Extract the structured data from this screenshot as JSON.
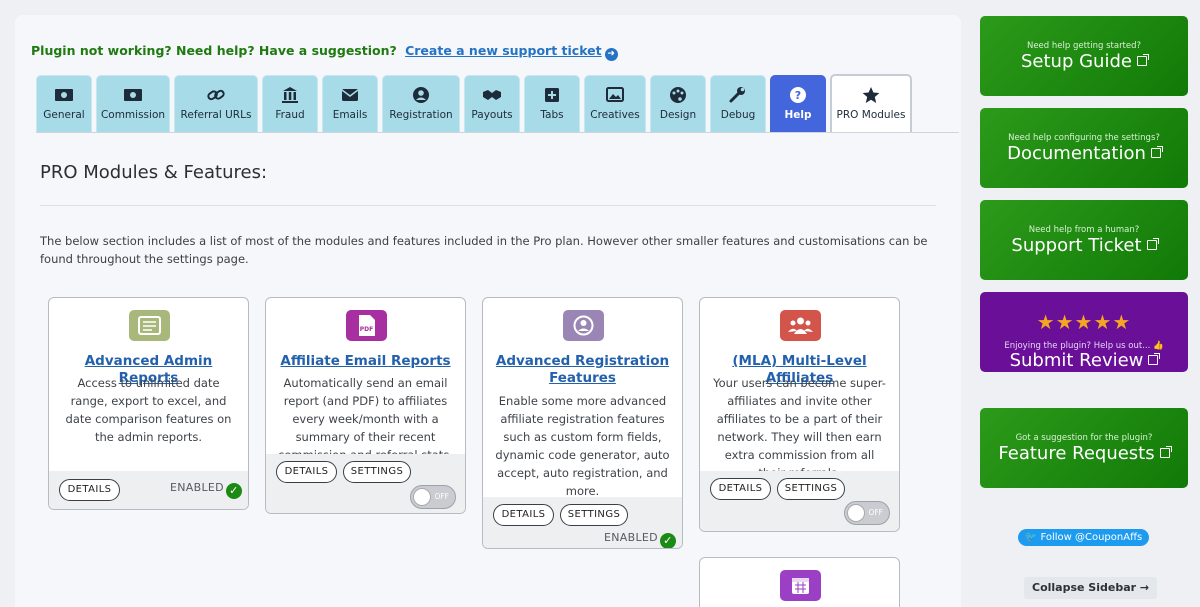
{
  "help_bar": {
    "prompt": "Plugin not working? Need help? Have a suggestion?",
    "link": "Create a new support ticket",
    "arrow": "➜"
  },
  "tabs": [
    {
      "label": "General",
      "icon": "money-icon"
    },
    {
      "label": "Commission",
      "icon": "money-icon"
    },
    {
      "label": "Referral URLs",
      "icon": "link-icon"
    },
    {
      "label": "Fraud",
      "icon": "building-icon"
    },
    {
      "label": "Emails",
      "icon": "envelope-icon"
    },
    {
      "label": "Registration",
      "icon": "user-circle-icon"
    },
    {
      "label": "Payouts",
      "icon": "handshake-icon"
    },
    {
      "label": "Tabs",
      "icon": "plus-folder-icon"
    },
    {
      "label": "Creatives",
      "icon": "images-icon"
    },
    {
      "label": "Design",
      "icon": "palette-icon"
    },
    {
      "label": "Debug",
      "icon": "wrench-icon"
    },
    {
      "label": "Help",
      "icon": "question-icon"
    },
    {
      "label": "PRO Modules",
      "icon": "star-icon"
    }
  ],
  "section": {
    "title": "PRO Modules & Features:",
    "intro": "The below section includes a list of most of the modules and features included in the Pro plan. However other smaller features and customisations can be found throughout the settings page."
  },
  "cards": [
    {
      "title": "Advanced Admin Reports",
      "description": "Access to unlimited date range, export to excel, and date comparison features on the admin reports.",
      "details": "DETAILS",
      "status": "ENABLED",
      "icon": "report-icon",
      "color": "#a8b87a"
    },
    {
      "title": "Affiliate Email Reports",
      "description": "Automatically send an email report (and PDF) to affiliates every week/month with a summary of their recent commission and referral stats.",
      "details": "DETAILS",
      "settings": "SETTINGS",
      "toggle": "OFF",
      "icon": "pdf-icon",
      "color": "#a82fa0"
    },
    {
      "title": "Advanced Registration Features",
      "description": "Enable some more advanced affiliate registration features such as custom form fields, dynamic code generator, auto accept, auto registration, and more.",
      "details": "DETAILS",
      "settings": "SETTINGS",
      "status": "ENABLED",
      "icon": "user-circle-icon",
      "color": "#9a86b4"
    },
    {
      "title": "(MLA) Multi-Level Affiliates",
      "description": "Your users can become super-affiliates and invite other affiliates to be a part of their network. They will then earn extra commission from all their referrals.",
      "details": "DETAILS",
      "settings": "SETTINGS",
      "toggle": "OFF",
      "icon": "users-icon",
      "color": "#d3544a"
    }
  ],
  "sidebar": {
    "setup": {
      "sub": "Need help getting started?",
      "big": "Setup Guide"
    },
    "docs": {
      "sub": "Need help configuring the settings?",
      "big": "Documentation"
    },
    "support": {
      "sub": "Need help from a human?",
      "big": "Support Ticket"
    },
    "review": {
      "stars": "★★★★★",
      "sub": "Enjoying the plugin? Help us out... 👍",
      "big": "Submit Review"
    },
    "feature": {
      "sub": "Got a suggestion for the plugin?",
      "big": "Feature Requests"
    },
    "follow": "🐦 Follow @CouponAffs",
    "collapse": "Collapse Sidebar",
    "collapse_arrow": "→"
  },
  "colors": {
    "tab": "#a7dbe8",
    "tab_help": "#4466dd",
    "link": "#2361ac",
    "green": "#1d8a16",
    "purple": "#6a0f98"
  }
}
